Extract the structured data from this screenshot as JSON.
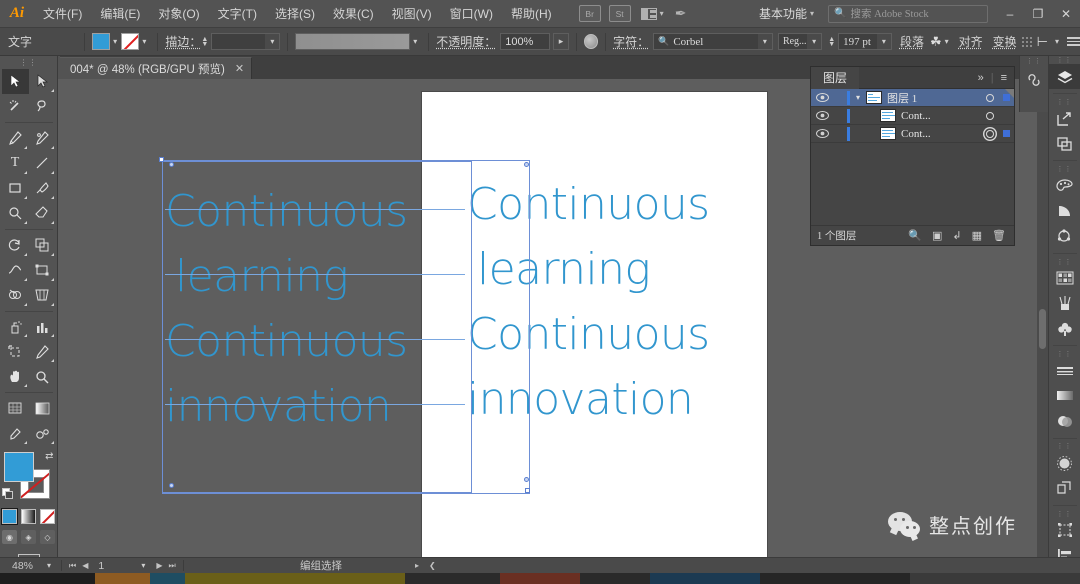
{
  "app": {
    "name": "Ai",
    "logo_text": "Ai"
  },
  "menubar": {
    "items": [
      "文件(F)",
      "编辑(E)",
      "对象(O)",
      "文字(T)",
      "选择(S)",
      "效果(C)",
      "视图(V)",
      "窗口(W)",
      "帮助(H)"
    ],
    "icons": [
      {
        "name": "bridge-icon",
        "label": "Br"
      },
      {
        "name": "stock-icon",
        "label": "St"
      },
      {
        "name": "arrange-documents-icon",
        "label": ""
      },
      {
        "name": "adobe-cc-icon",
        "label": "✒"
      }
    ],
    "workspace": "基本功能",
    "search_placeholder": "搜索 Adobe Stock",
    "window_controls": [
      "–",
      "❐",
      "✕"
    ]
  },
  "controlbar": {
    "tool_label": "文字",
    "fill_color": "#329cd6",
    "stroke_color": "none",
    "stroke_label": "描边：",
    "stroke_weight": "",
    "opacity_label": "不透明度：",
    "opacity_value": "100%",
    "char_label": "字符：",
    "font_family": "Corbel",
    "font_style": "Reg...",
    "font_size": "197 pt",
    "paragraph_label": "段落",
    "align_label": "对齐",
    "transform_label": "变换"
  },
  "tabs": {
    "documents": [
      {
        "title": "004* @ 48% (RGB/GPU 预览)",
        "close": "✕",
        "active": true
      }
    ]
  },
  "toolbar": {
    "tools": [
      {
        "name": "selection-tool",
        "active": true
      },
      {
        "name": "direct-selection-tool",
        "active": false
      },
      {
        "name": "magic-wand-tool",
        "active": false
      },
      {
        "name": "lasso-tool",
        "active": false
      },
      {
        "name": "pen-tool",
        "active": false
      },
      {
        "name": "curvature-tool",
        "active": false
      },
      {
        "name": "type-tool",
        "active": false
      },
      {
        "name": "line-segment-tool",
        "active": false
      },
      {
        "name": "rectangle-tool",
        "active": false
      },
      {
        "name": "paintbrush-tool",
        "active": false
      },
      {
        "name": "shaper-tool",
        "active": false
      },
      {
        "name": "eraser-tool",
        "active": false
      },
      {
        "name": "rotate-tool",
        "active": false
      },
      {
        "name": "scale-tool",
        "active": false
      },
      {
        "name": "width-tool",
        "active": false
      },
      {
        "name": "free-transform-tool",
        "active": false
      },
      {
        "name": "shape-builder-tool",
        "active": false
      },
      {
        "name": "perspective-grid-tool",
        "active": false
      },
      {
        "name": "mesh-tool",
        "active": false
      },
      {
        "name": "gradient-tool",
        "active": false
      },
      {
        "name": "eyedropper-tool",
        "active": false
      },
      {
        "name": "blend-tool",
        "active": false
      },
      {
        "name": "symbol-sprayer-tool",
        "active": false
      },
      {
        "name": "column-graph-tool",
        "active": false
      },
      {
        "name": "artboard-tool",
        "active": false
      },
      {
        "name": "slice-tool",
        "active": false
      },
      {
        "name": "hand-tool",
        "active": false
      },
      {
        "name": "zoom-tool",
        "active": false
      }
    ],
    "fill_swatch": "#329cd6",
    "stroke_swatch": "none",
    "mini_swatches": [
      "#329cd6",
      "gradient",
      "none"
    ],
    "draw_modes": [
      "draw-normal",
      "draw-behind",
      "draw-inside"
    ]
  },
  "canvas": {
    "background": "#5e5e5e",
    "artboard_color": "#ffffff",
    "text_color": "#3196ce",
    "artboard_text_lines": [
      "Continuous",
      " learning",
      "Continuous",
      "innovation"
    ],
    "selected_text_lines": [
      "Continuous",
      " learning",
      "Continuous",
      "innovation"
    ],
    "selection_color": "#6d8fd6"
  },
  "layers_panel": {
    "title": "图层",
    "collapse_icon": "»",
    "menu_icon": "≡",
    "rows": [
      {
        "name": "图层 1",
        "selected": true,
        "visible": true,
        "targeted": false,
        "has_selection_box": true,
        "expanded": true,
        "type": "layer"
      },
      {
        "name": "Cont...",
        "selected": false,
        "visible": true,
        "targeted": false,
        "has_selection_box": false,
        "type": "text"
      },
      {
        "name": "Cont...",
        "selected": false,
        "visible": true,
        "targeted": true,
        "has_selection_box": true,
        "type": "text"
      }
    ],
    "footer_count": "1 个图层",
    "footer_icons": [
      "locate-object-icon",
      "make-clipping-mask-icon",
      "create-sublayer-icon",
      "new-layer-icon",
      "delete-layer-icon"
    ]
  },
  "right_rail": {
    "buttons": [
      {
        "name": "layers-panel-icon",
        "active": true
      },
      {
        "name": "libraries-panel-icon",
        "active": false
      },
      {
        "name": "export-panel-icon",
        "active": false
      },
      {
        "name": "asset-export-icon",
        "active": false
      },
      {
        "name": "color-panel-icon",
        "active": false
      },
      {
        "name": "color-guide-icon",
        "active": false
      },
      {
        "name": "recolor-artwork-icon",
        "active": false
      },
      {
        "name": "swatches-panel-icon",
        "active": false
      },
      {
        "name": "brushes-panel-icon",
        "active": false
      },
      {
        "name": "symbols-panel-icon",
        "active": false
      },
      {
        "name": "stroke-panel-icon",
        "active": false
      },
      {
        "name": "gradient-panel-icon",
        "active": false
      },
      {
        "name": "transparency-panel-icon",
        "active": false
      },
      {
        "name": "appearance-panel-icon",
        "active": false
      },
      {
        "name": "graphic-styles-icon",
        "active": false
      },
      {
        "name": "transform-panel-icon",
        "active": false
      },
      {
        "name": "align-panel-icon",
        "active": false
      }
    ]
  },
  "statusbar": {
    "zoom": "48%",
    "page_number": "1",
    "status_text": "编组选择",
    "nav_first": "⏮",
    "nav_prev": "◀",
    "nav_next": "▶",
    "nav_last": "⏭"
  },
  "watermark": {
    "text": "整点创作",
    "icon": "wechat-icon"
  }
}
